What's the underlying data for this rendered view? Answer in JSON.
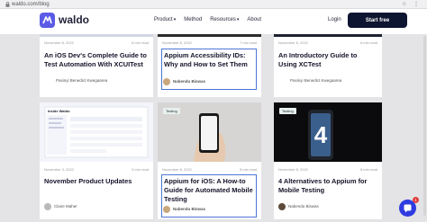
{
  "browser": {
    "url": "waldo.com/blog",
    "icons": "☆ ⋮"
  },
  "nav": {
    "logo_text": "waldo",
    "links": [
      "Product",
      "Method",
      "Resources",
      "About"
    ],
    "login": "Login",
    "cta": "Start free",
    "brand_color": "#5b5be6"
  },
  "cards": [
    {
      "date": "November 8, 2022",
      "read": "8 min read",
      "title": "An iOS Dev's Complete Guide to Test Automation With XCUITest",
      "author": "Pasinyi Benedict Kwegaarea"
    },
    {
      "date": "November 8, 2022",
      "read": "7 min read",
      "title": "Appium Accessibility IDs: Why and How to Set Them",
      "author": "Nabendu Biswas"
    },
    {
      "date": "November 8, 2022",
      "read": "8 min read",
      "title": "An Introductory Guide to Using XCTest",
      "author": "Pasinyi Benedict Kwegaarea"
    },
    {
      "date": "November 3, 2022",
      "read": "3 min read",
      "title": "November Product Updates",
      "author": "Claire Maher",
      "image_label": "Inside Waldo"
    },
    {
      "date": "November 8, 2022",
      "read": "8 min read",
      "title": "Appium for iOS: A How-to Guide for Automated Mobile Testing",
      "author": "Nabendu Biswas",
      "tag": "Testing"
    },
    {
      "date": "November 8, 2022",
      "read": "8 min read",
      "title": "4 Alternatives to Appium for Mobile Testing",
      "author": "Nabendu Biswas",
      "tag": "Testing"
    }
  ],
  "chat": {
    "badge": "1"
  }
}
